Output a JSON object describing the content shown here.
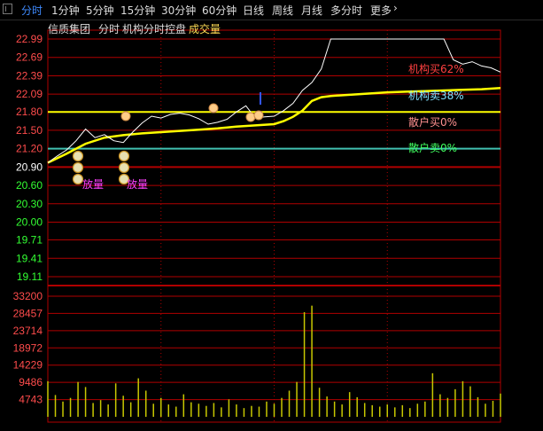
{
  "tabs": [
    "分时",
    "1分钟",
    "5分钟",
    "15分钟",
    "30分钟",
    "60分钟",
    "日线",
    "周线",
    "月线",
    "多分时",
    "更多"
  ],
  "active_tab": "分时",
  "header": {
    "stock_name": "信质集团",
    "mode": "分时",
    "indicator": "机构分时控盘",
    "volume_label": "成交量"
  },
  "legend": {
    "inst_buy": "机构买62%",
    "inst_sell": "机构卖38%",
    "retail_buy": "散户买0%",
    "retail_sell": "散户卖0%"
  },
  "markers": {
    "release": "放量"
  },
  "colors": {
    "price_line": "#ffffff",
    "avg_line": "#ffff00",
    "grid": "#b00000",
    "axis_up": "#ff4c4c",
    "axis_down": "#33ff33",
    "volume": "#c8c800",
    "retail_line": "#40c0b0"
  },
  "chart_data": {
    "type": "line",
    "price_axis": {
      "ticks": [
        "22.99",
        "22.69",
        "22.39",
        "22.09",
        "21.80",
        "21.50",
        "21.20",
        "20.90",
        "20.60",
        "20.30",
        "20.00",
        "19.71",
        "19.41",
        "19.11"
      ],
      "reference": 20.9,
      "range": [
        19.11,
        22.99
      ]
    },
    "volume_axis": {
      "ticks": [
        "33200",
        "28457",
        "23714",
        "18972",
        "14229",
        "9486",
        "4743"
      ],
      "range": [
        0,
        33200
      ]
    },
    "series": [
      {
        "name": "price",
        "x": [
          0,
          5,
          10,
          15,
          20,
          25,
          30,
          35,
          40,
          45,
          50,
          55,
          60,
          65,
          70,
          75,
          80,
          85,
          90,
          95,
          100,
          105,
          110,
          115,
          120,
          125,
          130,
          135,
          140,
          145,
          150,
          155,
          160,
          165,
          170,
          175,
          180,
          185,
          190,
          195,
          200,
          205,
          210,
          215,
          220,
          225,
          230,
          235,
          240
        ],
        "values": [
          20.97,
          21.08,
          21.18,
          21.33,
          21.52,
          21.38,
          21.43,
          21.33,
          21.3,
          21.47,
          21.62,
          21.73,
          21.7,
          21.76,
          21.78,
          21.75,
          21.69,
          21.6,
          21.63,
          21.68,
          21.8,
          21.9,
          21.7,
          21.72,
          21.73,
          21.82,
          21.94,
          22.15,
          22.28,
          22.5,
          22.99,
          22.99,
          22.99,
          22.99,
          22.99,
          22.99,
          22.99,
          22.99,
          22.99,
          22.99,
          22.99,
          22.99,
          22.99,
          22.65,
          22.58,
          22.62,
          22.55,
          22.52,
          22.45
        ]
      },
      {
        "name": "avg",
        "x": [
          0,
          10,
          20,
          30,
          40,
          50,
          60,
          70,
          80,
          90,
          100,
          110,
          120,
          125,
          130,
          135,
          140,
          145,
          150,
          160,
          170,
          180,
          190,
          200,
          210,
          220,
          230,
          240
        ],
        "values": [
          20.97,
          21.12,
          21.28,
          21.38,
          21.42,
          21.45,
          21.47,
          21.49,
          21.51,
          21.53,
          21.56,
          21.58,
          21.6,
          21.65,
          21.72,
          21.82,
          21.98,
          22.04,
          22.06,
          22.08,
          22.1,
          22.12,
          22.13,
          22.14,
          22.15,
          22.16,
          22.17,
          22.19
        ]
      },
      {
        "name": "volume",
        "x": [
          0,
          4,
          8,
          12,
          16,
          20,
          24,
          28,
          32,
          36,
          40,
          44,
          48,
          52,
          56,
          60,
          64,
          68,
          72,
          76,
          80,
          84,
          88,
          92,
          96,
          100,
          104,
          108,
          112,
          116,
          120,
          124,
          128,
          132,
          136,
          140,
          144,
          148,
          152,
          156,
          160,
          164,
          168,
          172,
          176,
          180,
          184,
          188,
          192,
          196,
          200,
          204,
          208,
          212,
          216,
          220,
          224,
          228,
          232,
          236,
          240
        ],
        "values": [
          9800,
          6000,
          4200,
          5200,
          9600,
          8200,
          3800,
          4600,
          3400,
          9200,
          5800,
          4000,
          10600,
          7200,
          3600,
          5200,
          3400,
          2800,
          6200,
          4000,
          3600,
          3000,
          3800,
          2600,
          4800,
          3400,
          2400,
          3000,
          2800,
          4200,
          3600,
          5200,
          7200,
          9600,
          28800,
          30600,
          8000,
          5600,
          4200,
          3400,
          6800,
          5400,
          3800,
          3200,
          2800,
          3400,
          2600,
          3200,
          2400,
          3600,
          4200,
          12000,
          6200,
          5200,
          7600,
          9800,
          8400,
          5400,
          3600,
          4400,
          6400
        ]
      }
    ]
  }
}
